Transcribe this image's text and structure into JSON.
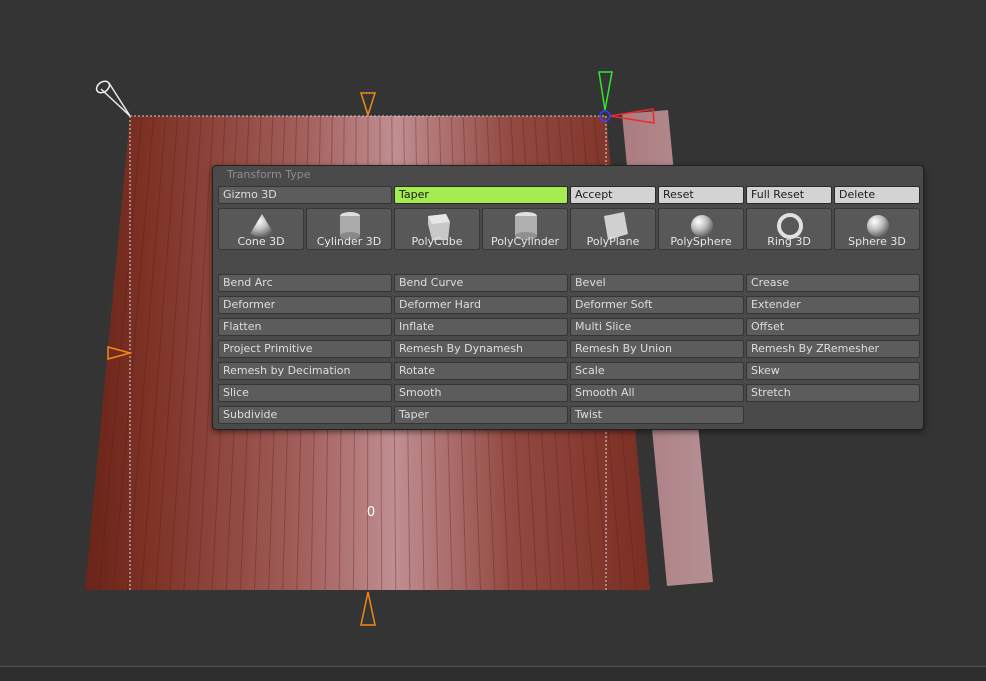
{
  "viewport": {
    "center_label": "0"
  },
  "panel": {
    "title": "Transform Type",
    "top_row": {
      "gizmo_label": "Gizmo 3D",
      "active_tool_label": "Taper",
      "accept_label": "Accept",
      "reset_label": "Reset",
      "full_reset_label": "Full Reset",
      "delete_label": "Delete"
    },
    "primitives": [
      {
        "label": "Cone 3D",
        "icon": "cone-icon"
      },
      {
        "label": "Cylinder 3D",
        "icon": "cylinder-icon"
      },
      {
        "label": "PolyCube",
        "icon": "cube-icon"
      },
      {
        "label": "PolyCylinder",
        "icon": "poly-cylinder-icon"
      },
      {
        "label": "PolyPlane",
        "icon": "plane-icon"
      },
      {
        "label": "PolySphere",
        "icon": "sphere-icon"
      },
      {
        "label": "Ring 3D",
        "icon": "ring-icon"
      },
      {
        "label": "Sphere 3D",
        "icon": "sphere-icon"
      }
    ],
    "deformers": [
      "Bend Arc",
      "Bend Curve",
      "Bevel",
      "Crease",
      "Deformer",
      "Deformer Hard",
      "Deformer Soft",
      "Extender",
      "Flatten",
      "Inflate",
      "Multi Slice",
      "Offset",
      "Project Primitive",
      "Remesh By Dynamesh",
      "Remesh By Union",
      "Remesh By ZRemesher",
      "Remesh by Decimation",
      "Rotate",
      "Scale",
      "Skew",
      "Slice",
      "Smooth",
      "Smooth All",
      "Stretch",
      "Subdivide",
      "Taper",
      "Twist"
    ]
  },
  "colors": {
    "active_accent": "#a4ec4f",
    "mesh_base": "#8a3a2e",
    "gizmo_orange": "#f08a14",
    "gizmo_green": "#2ee82e",
    "gizmo_red": "#ee2a2a",
    "gizmo_blue": "#3340ff"
  }
}
